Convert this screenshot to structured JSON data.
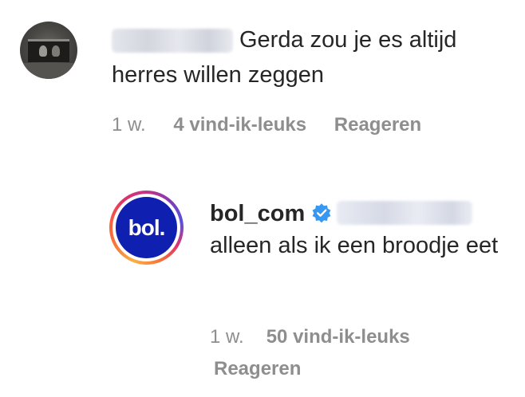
{
  "comment": {
    "text": "Gerda zou je es altijd herres willen zeggen",
    "time": "1 w.",
    "likes": "4 vind-ik-leuks",
    "reply_label": "Reageren"
  },
  "reply": {
    "username": "bol_com",
    "avatar_logo": "bol.",
    "verified_icon": "verified-badge-icon",
    "text": "alleen als ik een broodje eet",
    "time": "1 w.",
    "likes": "50 vind-ik-leuks",
    "reply_label": "Reageren"
  },
  "colors": {
    "text": "#262626",
    "meta": "#8e8e8e",
    "verified": "#3897f0",
    "brand_blue": "#0f1fb0"
  }
}
